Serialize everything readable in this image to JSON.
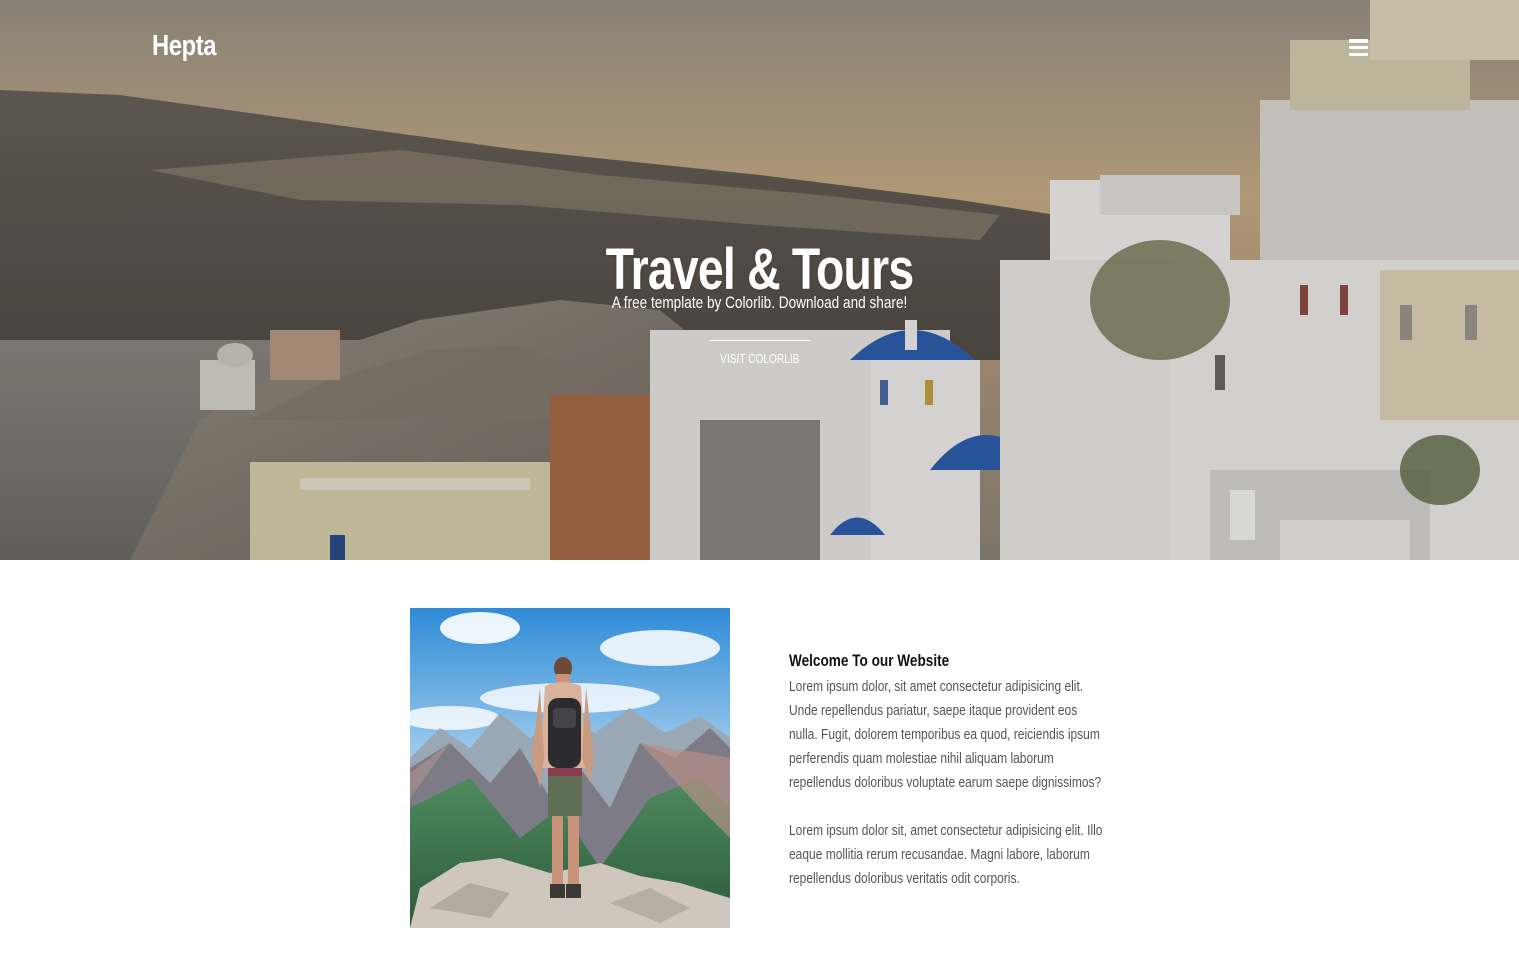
{
  "header": {
    "brand": "Hepta",
    "menu_icon": "hamburger-menu-icon"
  },
  "hero": {
    "title": "Travel & Tours",
    "subtitle": "A free template by Colorlib. Download and share!",
    "button_label": "VISIT COLORLIB",
    "image": "santorini-village-photo"
  },
  "welcome": {
    "image": "hiker-mountain-photo",
    "heading": "Welcome To our Website",
    "paragraphs": [
      "Lorem ipsum dolor, sit amet consectetur adipisicing elit. Unde repellendus pariatur, saepe itaque provident eos nulla. Fugit, dolorem temporibus ea quod, reiciendis ipsum perferendis quam molestiae nihil aliquam laborum repellendus doloribus voluptate earum saepe dignissimos?",
      "Lorem ipsum dolor sit, amet consectetur adipisicing elit. Illo eaque mollitia rerum recusandae. Magni labore, laborum repellendus doloribus veritatis odit corporis."
    ]
  },
  "colors": {
    "hero_text": "#ffffff",
    "heading": "#111111",
    "body_text": "#555555",
    "dome_blue": "#2f5fae"
  }
}
